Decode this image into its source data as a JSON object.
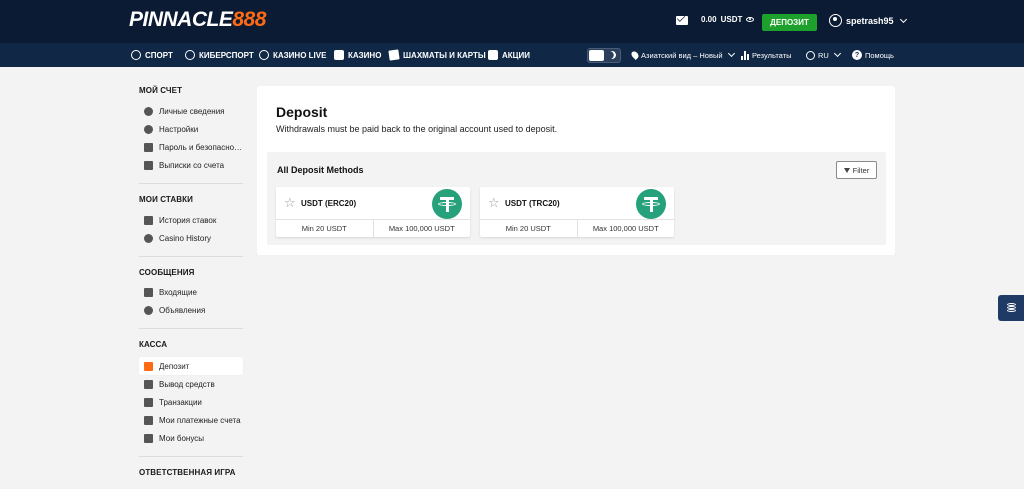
{
  "header": {
    "logo_white": "PINNACLE",
    "logo_orange": "888",
    "balance_amount": "0.00",
    "balance_currency": "USDT",
    "deposit_label": "ДЕПОЗИТ",
    "username": "spetrash95"
  },
  "nav": {
    "items": [
      {
        "label": "СПОРТ",
        "icon": "soccer-ball-icon"
      },
      {
        "label": "КИБЕРСПОРТ",
        "icon": "headset-icon"
      },
      {
        "label": "КАЗИНО LIVE",
        "icon": "live-chip-icon"
      },
      {
        "label": "КАЗИНО",
        "icon": "casino-icon"
      },
      {
        "label": "ШАХМАТЫ И КАРТЫ",
        "icon": "cards-icon"
      },
      {
        "label": "АКЦИИ",
        "icon": "gift-icon"
      }
    ],
    "odds_view": "Азиатский вид – Новый",
    "results": "Результаты",
    "language": "RU",
    "help": "Помощь"
  },
  "sidebar": {
    "sections": [
      {
        "title": "МОЙ СЧЕТ",
        "items": [
          "Личные сведения",
          "Настройки",
          "Пароль и безопасно…",
          "Выписки со счета"
        ]
      },
      {
        "title": "МОИ СТАВКИ",
        "items": [
          "История ставок",
          "Casino History"
        ]
      },
      {
        "title": "СООБЩЕНИЯ",
        "items": [
          "Входящие",
          "Объявления"
        ]
      },
      {
        "title": "КАССА",
        "items": [
          "Депозит",
          "Вывод средств",
          "Транзакции",
          "Мои платежные счета",
          "Мои бонусы"
        ]
      },
      {
        "title": "ОТВЕТСТВЕННАЯ ИГРА",
        "items": []
      }
    ],
    "active_item": "Депозит"
  },
  "main": {
    "title": "Deposit",
    "subtitle": "Withdrawals must be paid back to the original account used to deposit.",
    "methods_title": "All Deposit Methods",
    "filter_label": "Filter",
    "methods": [
      {
        "name": "USDT (ERC20)",
        "min": "Min 20 USDT",
        "max": "Max 100,000 USDT"
      },
      {
        "name": "USDT (TRC20)",
        "min": "Min 20 USDT",
        "max": "Max 100,000 USDT"
      }
    ]
  },
  "colors": {
    "header_bg": "#0a1b33",
    "nav_bg": "#102846",
    "accent_orange": "#ff6a13",
    "deposit_green": "#1ea02c",
    "tether_green": "#26a17b"
  }
}
